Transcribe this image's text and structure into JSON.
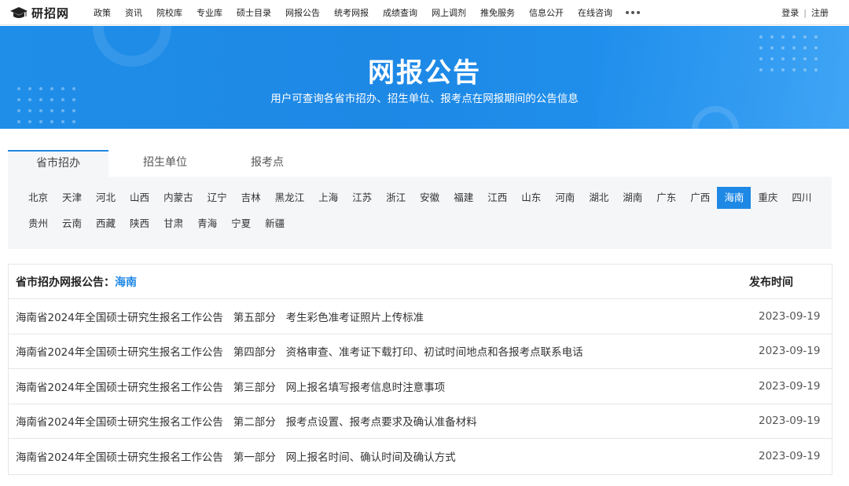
{
  "logo": {
    "text": "研招网"
  },
  "nav": {
    "items": [
      "政策",
      "资讯",
      "院校库",
      "专业库",
      "硕士目录",
      "网报公告",
      "统考网报",
      "成绩查询",
      "网上调剂",
      "推免服务",
      "信息公开",
      "在线咨询"
    ]
  },
  "auth": {
    "login": "登录",
    "separator": "|",
    "register": "注册"
  },
  "banner": {
    "title": "网报公告",
    "subtitle": "用户可查询各省市招办、招生单位、报考点在网报期间的公告信息"
  },
  "tabs": [
    {
      "label": "省市招办",
      "active": true
    },
    {
      "label": "招生单位",
      "active": false
    },
    {
      "label": "报考点",
      "active": false
    }
  ],
  "provinces": {
    "row1": [
      "北京",
      "天津",
      "河北",
      "山西",
      "内蒙古",
      "辽宁",
      "吉林",
      "黑龙江",
      "上海",
      "江苏",
      "浙江",
      "安徽",
      "福建",
      "江西",
      "山东",
      "河南",
      "湖北",
      "湖南",
      "广东",
      "广西",
      "海南",
      "重庆",
      "四川"
    ],
    "row2": [
      "贵州",
      "云南",
      "西藏",
      "陕西",
      "甘肃",
      "青海",
      "宁夏",
      "新疆"
    ],
    "selected": "海南"
  },
  "table": {
    "header_prefix": "省市招办网报公告：",
    "header_region": "海南",
    "header_date": "发布时间",
    "rows": [
      {
        "title": "海南省2024年全国硕士研究生报名工作公告   第五部分   考生彩色准考证照片上传标准",
        "date": "2023-09-19"
      },
      {
        "title": "海南省2024年全国硕士研究生报名工作公告   第四部分   资格审查、准考证下载打印、初试时间地点和各报考点联系电话",
        "date": "2023-09-19"
      },
      {
        "title": "海南省2024年全国硕士研究生报名工作公告   第三部分   网上报名填写报考信息时注意事项",
        "date": "2023-09-19"
      },
      {
        "title": "海南省2024年全国硕士研究生报名工作公告   第二部分   报考点设置、报考点要求及确认准备材料",
        "date": "2023-09-19"
      },
      {
        "title": "海南省2024年全国硕士研究生报名工作公告   第一部分   网上报名时间、确认时间及确认方式",
        "date": "2023-09-19"
      }
    ]
  },
  "colors": {
    "accent": "#1e88e5",
    "panel_bg": "#f5f6f8",
    "border": "#e6e6e6"
  }
}
